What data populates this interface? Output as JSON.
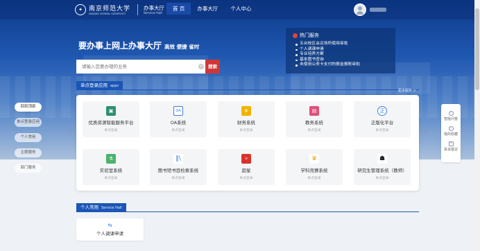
{
  "header": {
    "school_name_cn": "南京师范大学",
    "school_name_en": "NANJING NORMAL UNIVERSITY",
    "hall_cn": "办事大厅",
    "hall_en": "Service Hall",
    "nav": [
      "首 页",
      "办事大厅",
      "个人中心"
    ]
  },
  "hero": {
    "headline": "要办事上网上办事大厅",
    "tagline": "高效 便捷 省时"
  },
  "search": {
    "placeholder": "请输入您要办理的业务",
    "button": "搜索"
  },
  "hot_services": {
    "title": "热门服务",
    "items": [
      "五台校区会议场所使用审批",
      "个人调课申请",
      "专业培养方案",
      "基本图书查询",
      "未使用公务卡支付的报金报账审批"
    ]
  },
  "sso_section": {
    "title": "单点登录应用",
    "en": "apps",
    "more": "更多服务 >"
  },
  "left_nav": [
    "回到顶部",
    "单点登录应用",
    "个人常用",
    "主题服务",
    "部门服务"
  ],
  "apps": [
    {
      "name": "优质资源智能服务平台",
      "sub": "单点登录",
      "color": "#2f8f6f",
      "icon": "resource-icon"
    },
    {
      "name": "OA系统",
      "sub": "单点登录",
      "color": "#3b7de0",
      "icon": "oa-icon"
    },
    {
      "name": "财务系统",
      "sub": "单点登录",
      "color": "#f2b300",
      "icon": "finance-icon"
    },
    {
      "name": "教务系统",
      "sub": "单点登录",
      "color": "#e0507a",
      "icon": "printer-icon"
    },
    {
      "name": "正版化平台",
      "sub": "单点登录",
      "color": "#3b7de0",
      "icon": "license-icon"
    },
    {
      "name": "实验室系统",
      "sub": "单点登录",
      "color": "#4bb36b",
      "icon": "lab-icon"
    },
    {
      "name": "图书馆书目检索系统",
      "sub": "单点登录",
      "color": "#3b7de0",
      "icon": "library-icon"
    },
    {
      "name": "超星",
      "sub": "单点登录",
      "color": "#d8322a",
      "icon": "chaoxing-icon"
    },
    {
      "name": "学科竞赛系统",
      "sub": "单点登录",
      "color": "#f2a500",
      "icon": "trophy-icon"
    },
    {
      "name": "研究生管理系统（教师）",
      "sub": "单点登录",
      "color": "#2a2a2a",
      "icon": "graduate-icon"
    }
  ],
  "right_bar": [
    "智能问答",
    "我的收藏",
    "投诉建议"
  ],
  "personal_section": {
    "title": "个人常用",
    "en": "Service Hall"
  },
  "personal_items": [
    {
      "name": "个人调课申请",
      "icon": "swap-icon"
    }
  ]
}
